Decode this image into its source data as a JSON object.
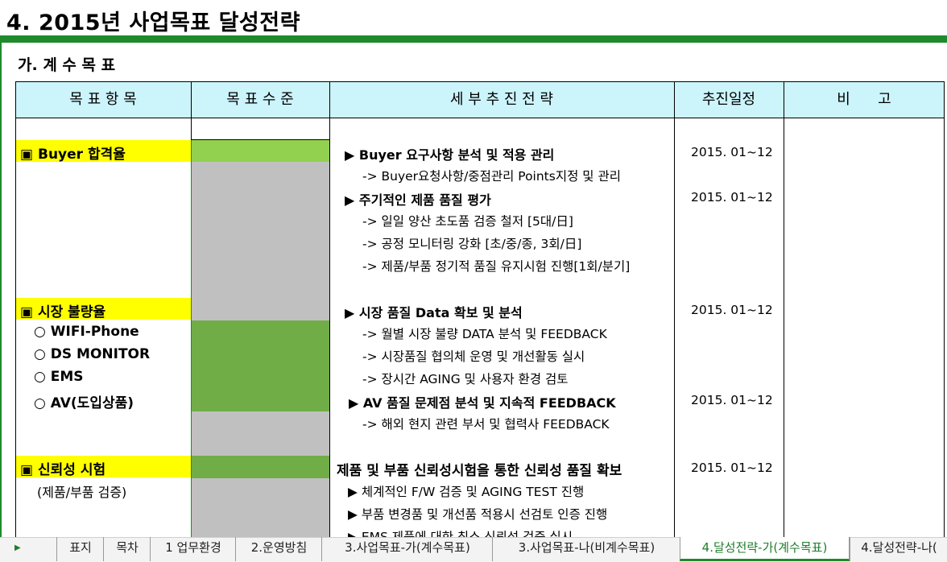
{
  "title": "4. 2015년 사업목표 달성전략",
  "subtitle": "가. 계 수 목 표",
  "headers": {
    "item": "목 표 항 목",
    "level": "목 표 수 준",
    "strategy": "세 부 추 진 전 략",
    "schedule": "추진일정",
    "note": "비      고"
  },
  "targets": {
    "buyer": "▣ Buyer 합격율",
    "market": "▣ 시장 불량율",
    "market_items": [
      "○ WIFI-Phone",
      "○ DS MONITOR",
      "○ EMS",
      "○ AV(도입상품)"
    ],
    "reliability": "▣ 신뢰성 시험",
    "reliability_sub": "(제품/부품 검증)"
  },
  "strategies": {
    "s1": "▶ Buyer 요구사항 분석 및 적용 관리",
    "s1_d1": "-> Buyer요청사항/중점관리 Points지정 및 관리",
    "s2": "▶ 주기적인 제품 품질 평가",
    "s2_d1": "-> 일일 양산 초도품 검증 철저 [5대/日]",
    "s2_d2": "-> 공정 모니터링 강화 [초/중/종, 3회/日]",
    "s2_d3": "-> 제품/부품 정기적 품질 유지시험 진행[1회/분기]",
    "s3": "▶ 시장 품질 Data 확보 및 분석",
    "s3_d1": "-> 월별 시장 불량 DATA 분석 및 FEEDBACK",
    "s3_d2": "-> 시장품질 협의체 운영 및 개선활동 실시",
    "s3_d3": "-> 장시간 AGING 및 사용자 환경 검토",
    "s4": "▶ AV 품질 문제점 분석 및 지속적 FEEDBACK",
    "s4_d1": "-> 해외 현지 관련 부서 및 협력사 FEEDBACK",
    "s5": "제품 및 부품 신뢰성시험을 통한 신뢰성 품질 확보",
    "s5_d1": "▶ 체계적인 F/W 검증 및 AGING TEST 진행",
    "s5_d2": "▶ 부품 변경품 및 개선품 적용시 선검토 인증 진행",
    "s5_d3": "▶ EMS 제품에 대한 최소 신뢰성 검증 실시"
  },
  "schedules": [
    "2015. 01~12",
    "2015. 01~12",
    "2015. 01~12",
    "2015. 01~12",
    "2015. 01~12"
  ],
  "colors": {
    "accent_green": "#1e8a2c",
    "header_bg": "#ccf4fb",
    "highlight_yellow": "#ffff00",
    "level_light_green": "#92d050",
    "level_dark_green": "#70ad47",
    "level_gray": "#c0c0c0"
  },
  "tabs": [
    "표지",
    "목차",
    "1 업무환경",
    "2.운영방침",
    "3.사업목표-가(계수목표)",
    "3.사업목표-나(비계수목표)",
    "4.달성전략-가(계수목표)",
    "4.달성전략-나("
  ],
  "active_tab": "4.달성전략-가(계수목표)",
  "nav_icon": "play-triangle-icon"
}
